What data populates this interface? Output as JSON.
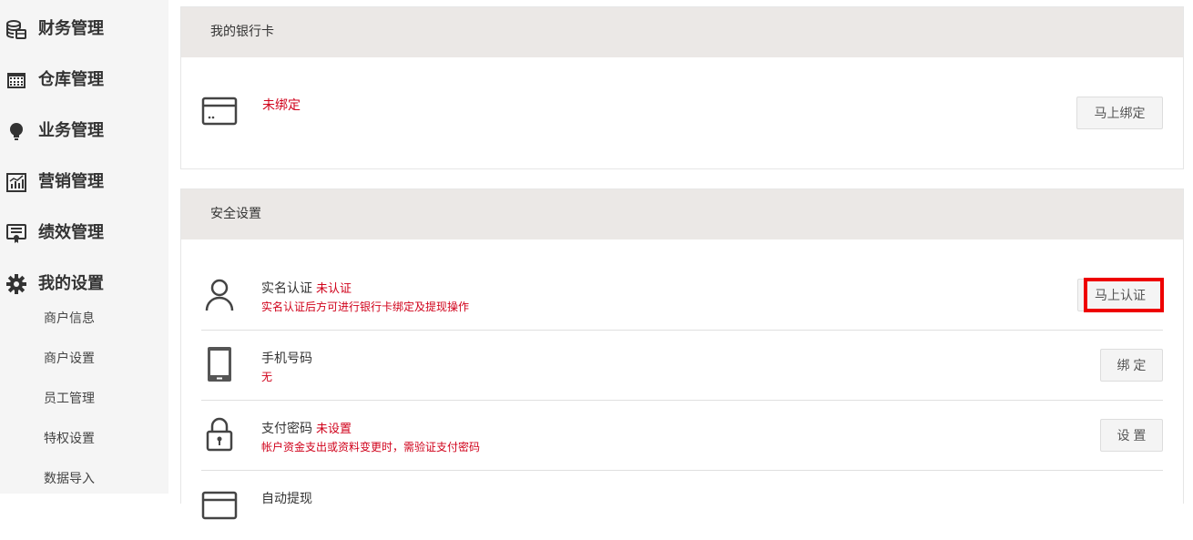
{
  "sidebar": {
    "groups": [
      {
        "label": "财务管理",
        "icon": "coin-stack-icon"
      },
      {
        "label": "仓库管理",
        "icon": "warehouse-icon"
      },
      {
        "label": "业务管理",
        "icon": "lightbulb-icon"
      },
      {
        "label": "营销管理",
        "icon": "chart-icon"
      },
      {
        "label": "绩效管理",
        "icon": "certificate-icon"
      },
      {
        "label": "我的设置",
        "icon": "gear-icon"
      }
    ],
    "sub_items": [
      "商户信息",
      "商户设置",
      "员工管理",
      "特权设置",
      "数据导入"
    ]
  },
  "bank_card": {
    "header": "我的银行卡",
    "status": "未绑定",
    "button": "马上绑定",
    "icon": "bank-card-icon"
  },
  "security": {
    "header": "安全设置",
    "rows": [
      {
        "title": "实名认证",
        "status": "未认证",
        "desc": "实名认证后方可进行银行卡绑定及提现操作",
        "button": "马上认证",
        "icon": "user-icon"
      },
      {
        "title": "手机号码",
        "status": "",
        "desc": "无",
        "button": "绑 定",
        "icon": "tablet-icon"
      },
      {
        "title": "支付密码",
        "status": "未设置",
        "desc": "帐户资金支出或资料变更时，需验证支付密码",
        "button": "设 置",
        "icon": "lock-icon"
      },
      {
        "title": "自动提现",
        "status": "",
        "desc": "",
        "button": "",
        "icon": "card-icon"
      }
    ]
  },
  "colors": {
    "accent_red": "#d0021b",
    "header_bg": "#ebe8e6",
    "highlight": "#ee0000"
  }
}
